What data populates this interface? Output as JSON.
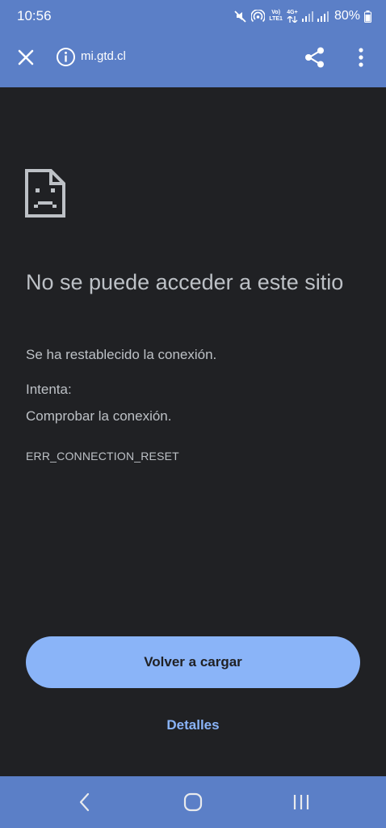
{
  "status_bar": {
    "time": "10:56",
    "lte_top": "Vo)",
    "lte_bottom": "LTE1",
    "net_top": "4G+",
    "battery": "80%"
  },
  "toolbar": {
    "url": "mi.gtd.cl",
    "icons": [
      "close-icon",
      "info-icon",
      "share-icon",
      "more-vert-icon"
    ]
  },
  "error_page": {
    "heading": "No se puede acceder a este sitio",
    "message": "Se ha restablecido la conexión.",
    "try_label": "Intenta:",
    "suggestion": "Comprobar la conexión.",
    "error_code": "ERR_CONNECTION_RESET",
    "reload_label": "Volver a cargar",
    "details_label": "Detalles"
  },
  "nav_bar": {
    "icons": [
      "back-icon",
      "home-icon",
      "recents-icon"
    ]
  },
  "colors": {
    "top_bar": "#5b7fc7",
    "background": "#202124",
    "text": "#bdc1c6",
    "accent": "#8ab4f8"
  }
}
